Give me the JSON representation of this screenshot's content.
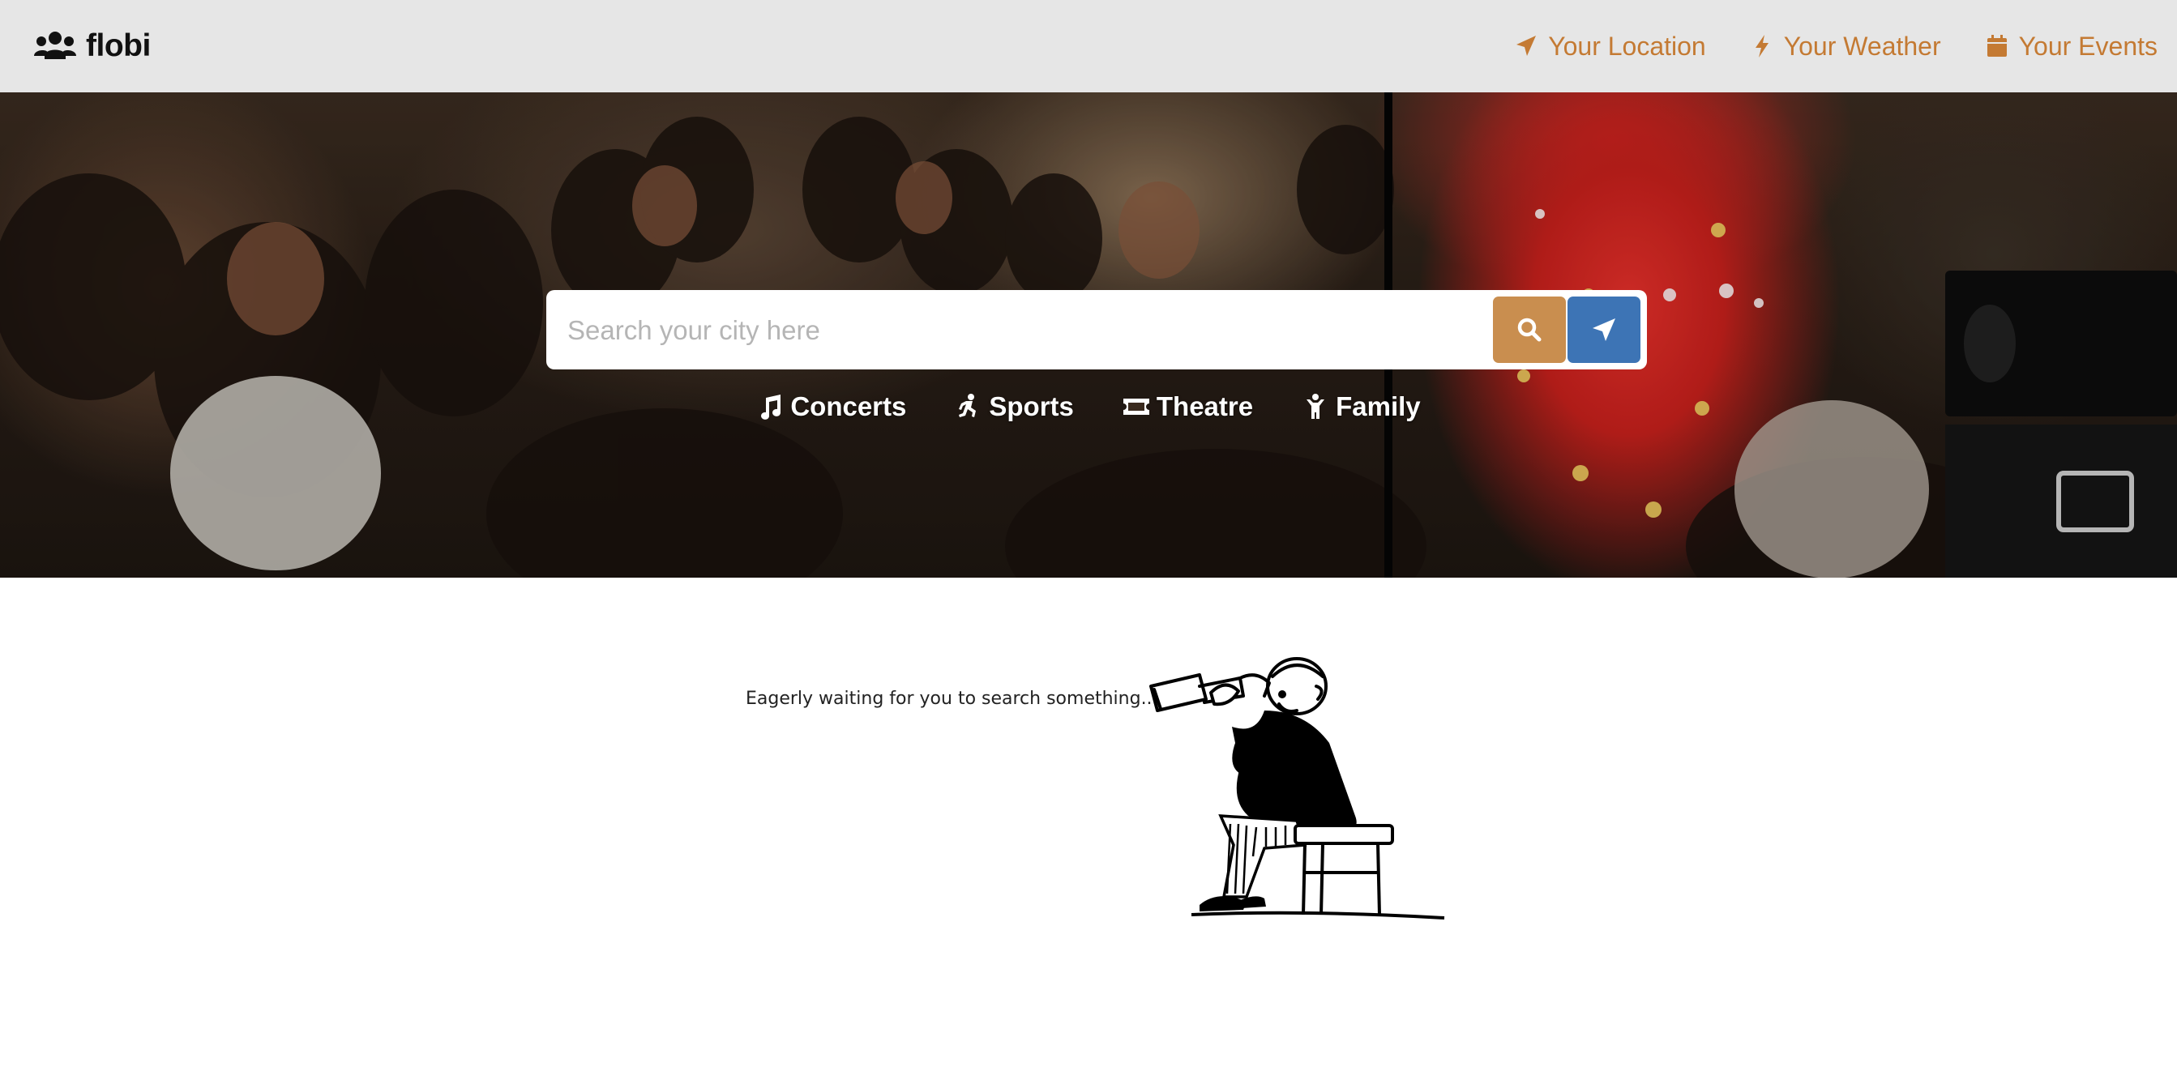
{
  "brand": {
    "name": "flobi",
    "icon": "users-icon"
  },
  "nav": {
    "items": [
      {
        "label": "Your Location",
        "icon": "location-arrow-icon"
      },
      {
        "label": "Your Weather",
        "icon": "bolt-icon"
      },
      {
        "label": "Your Events",
        "icon": "calendar-icon"
      }
    ]
  },
  "hero": {
    "search": {
      "placeholder": "Search your city here"
    },
    "categories": [
      {
        "label": "Concerts",
        "icon": "music-icon"
      },
      {
        "label": "Sports",
        "icon": "running-icon"
      },
      {
        "label": "Theatre",
        "icon": "ticket-icon"
      },
      {
        "label": "Family",
        "icon": "child-icon"
      }
    ]
  },
  "main": {
    "empty_state_text": "Eagerly waiting for you to search something..."
  },
  "colors": {
    "navbar_bg": "#e6e6e6",
    "accent_orange": "#c47a33",
    "search_button": "#c98e4f",
    "locate_button": "#3d74b5"
  }
}
